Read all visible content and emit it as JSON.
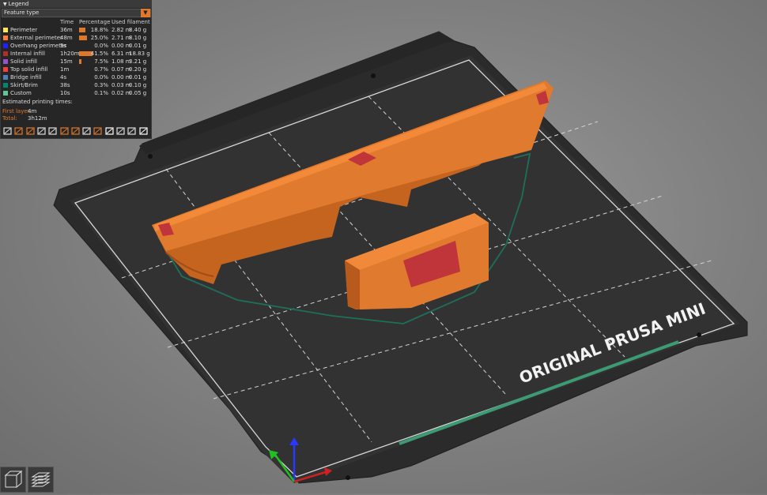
{
  "legend": {
    "title": "Legend",
    "view_type": "Feature type",
    "columns": {
      "time": "Time",
      "percentage": "Percentage",
      "filament": "Used filament"
    },
    "items": [
      {
        "name": "Perimeter",
        "color": "#ffe65a",
        "time": "36m",
        "percent": "18.8%",
        "percent_value": 18.8,
        "length": "2.82 m",
        "weight": "8.40 g"
      },
      {
        "name": "External perimeter",
        "color": "#ff7d38",
        "time": "48m",
        "percent": "25.0%",
        "percent_value": 25.0,
        "length": "2.71 m",
        "weight": "8.10 g"
      },
      {
        "name": "Overhang perimeter",
        "color": "#1f1fff",
        "time": "5s",
        "percent": "0.0%",
        "percent_value": 0.0,
        "length": "0.00 m",
        "weight": "0.01 g"
      },
      {
        "name": "Internal infill",
        "color": "#b03029",
        "time": "1h20m",
        "percent": "41.5%",
        "percent_value": 41.5,
        "length": "6.31 m",
        "weight": "18.83 g"
      },
      {
        "name": "Solid infill",
        "color": "#9654cc",
        "time": "15m",
        "percent": "7.5%",
        "percent_value": 7.5,
        "length": "1.08 m",
        "weight": "3.21 g"
      },
      {
        "name": "Top solid infill",
        "color": "#f04040",
        "time": "1m",
        "percent": "0.7%",
        "percent_value": 0.7,
        "length": "0.07 m",
        "weight": "0.20 g"
      },
      {
        "name": "Bridge infill",
        "color": "#4d80ba",
        "time": "4s",
        "percent": "0.0%",
        "percent_value": 0.0,
        "length": "0.00 m",
        "weight": "0.01 g"
      },
      {
        "name": "Skirt/Brim",
        "color": "#00876e",
        "time": "38s",
        "percent": "0.3%",
        "percent_value": 0.3,
        "length": "0.03 m",
        "weight": "0.10 g"
      },
      {
        "name": "Custom",
        "color": "#5ec994",
        "time": "10s",
        "percent": "0.1%",
        "percent_value": 0.1,
        "length": "0.02 m",
        "weight": "0.05 g"
      }
    ],
    "estimated_label": "Estimated printing times:",
    "first_layer_label": "First layer:",
    "first_layer_value": "4m",
    "total_label": "Total:",
    "total_value": "3h12m",
    "accent_color": "#e0782a"
  },
  "toolbar_icons": [
    "travel-icon",
    "wipe-icon",
    "retractions-icon",
    "deretractions-icon",
    "seams-icon",
    "tool-changes-icon",
    "color-changes-icon",
    "pause-icon",
    "custom-gcode-icon",
    "center-of-gravity-icon",
    "shells-icon",
    "tool-marker-icon",
    "export-toolpaths-icon"
  ],
  "bed": {
    "label": "ORIGINAL PRUSA MINI",
    "surface_color": "#2e2e2e",
    "grid_color": "#d8d8d8",
    "print_color": "#e07a2f",
    "infill_color": "#c0353a",
    "skirt_color": "#1e6f5a"
  },
  "view_buttons": [
    "3d-view-icon",
    "layers-view-icon"
  ]
}
